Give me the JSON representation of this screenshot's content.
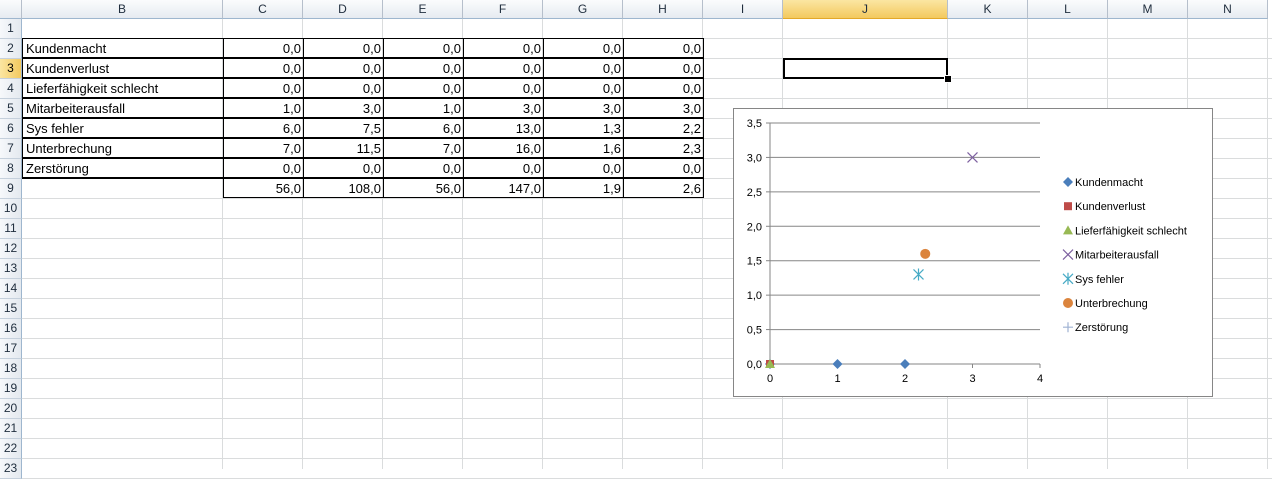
{
  "columns": [
    "B",
    "C",
    "D",
    "E",
    "F",
    "G",
    "H",
    "I",
    "J",
    "K",
    "L",
    "M",
    "N"
  ],
  "selected_column": "J",
  "rows": [
    "1",
    "2",
    "3",
    "4",
    "5",
    "6",
    "7",
    "8",
    "9",
    "10",
    "11",
    "12",
    "13",
    "14",
    "15",
    "16",
    "17",
    "18",
    "19",
    "20",
    "21",
    "22",
    "23"
  ],
  "selected_row": "3",
  "table": {
    "rows": [
      {
        "label": "Kundenmacht",
        "values": [
          "0,0",
          "0,0",
          "0,0",
          "0,0",
          "0,0",
          "0,0"
        ]
      },
      {
        "label": "Kundenverlust",
        "values": [
          "0,0",
          "0,0",
          "0,0",
          "0,0",
          "0,0",
          "0,0"
        ]
      },
      {
        "label": "Lieferfähigkeit schlecht",
        "values": [
          "0,0",
          "0,0",
          "0,0",
          "0,0",
          "0,0",
          "0,0"
        ]
      },
      {
        "label": "Mitarbeiterausfall",
        "values": [
          "1,0",
          "3,0",
          "1,0",
          "3,0",
          "3,0",
          "3,0"
        ]
      },
      {
        "label": "Sys fehler",
        "values": [
          "6,0",
          "7,5",
          "6,0",
          "13,0",
          "1,3",
          "2,2"
        ]
      },
      {
        "label": "Unterbrechung",
        "values": [
          "7,0",
          "11,5",
          "7,0",
          "16,0",
          "1,6",
          "2,3"
        ]
      },
      {
        "label": "Zerstörung",
        "values": [
          "0,0",
          "0,0",
          "0,0",
          "0,0",
          "0,0",
          "0,0"
        ]
      },
      {
        "label": "",
        "values": [
          "56,0",
          "108,0",
          "56,0",
          "147,0",
          "1,9",
          "2,6"
        ]
      }
    ]
  },
  "chart_data": {
    "type": "scatter",
    "title": "",
    "xlabel": "",
    "ylabel": "",
    "xlim": [
      0,
      4
    ],
    "ylim": [
      0,
      3.5
    ],
    "x_ticks": [
      "0",
      "1",
      "2",
      "3",
      "4"
    ],
    "y_ticks": [
      "0,0",
      "0,5",
      "1,0",
      "1,5",
      "2,0",
      "2,5",
      "3,0",
      "3,5"
    ],
    "grid": "horizontal",
    "legend_position": "right",
    "series": [
      {
        "name": "Kundenmacht",
        "marker": "diamond",
        "color": "#4a7ebb",
        "points": [
          [
            0,
            0
          ],
          [
            1,
            0
          ],
          [
            2,
            0
          ]
        ]
      },
      {
        "name": "Kundenverlust",
        "marker": "square",
        "color": "#be4b48",
        "points": [
          [
            0,
            0
          ]
        ]
      },
      {
        "name": "Lieferfähigkeit schlecht",
        "marker": "triangle",
        "color": "#98b954",
        "points": [
          [
            0,
            0
          ]
        ]
      },
      {
        "name": "Mitarbeiterausfall",
        "marker": "x",
        "color": "#7d60a0",
        "points": [
          [
            3,
            3
          ]
        ]
      },
      {
        "name": "Sys fehler",
        "marker": "star",
        "color": "#46aac5",
        "points": [
          [
            2.2,
            1.3
          ]
        ]
      },
      {
        "name": "Unterbrechung",
        "marker": "circle",
        "color": "#db843d",
        "points": [
          [
            2.3,
            1.6
          ]
        ]
      },
      {
        "name": "Zerstörung",
        "marker": "plus",
        "color": "#9fb2d3",
        "points": []
      }
    ]
  }
}
